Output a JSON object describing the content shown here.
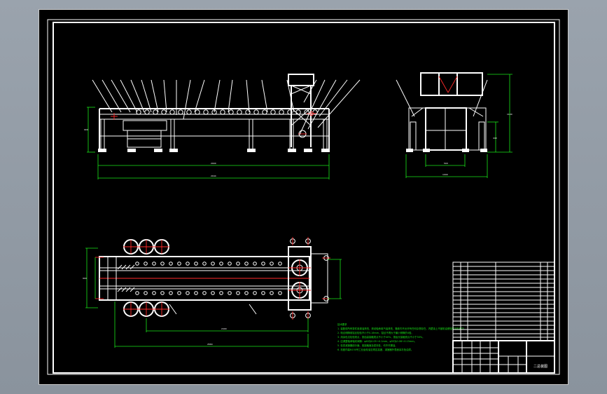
{
  "notes": {
    "title": "技术要求",
    "lines": [
      "1. 装配前所有零件用煤油清洗，滚动轴承用汽油清洗，箱体内不允许有任何杂物存在，内壁涂上不被机油侵蚀的涂料两次。",
      "2. 啮合侧隙用铅丝检验不小于0.16mm，铅丝不得大于最小侧隙的4倍。",
      "3. 用涂色法检验斑点，按齿高接触斑点不小于40%，按齿长接触斑点不小于50%。",
      "4. 应调整轴承轴向间隙：φ40为0.05～0.1mm，φ55为0.08～0.15mm。",
      "5. 检查减速器剖分面、各接触面及密封处，均不许漏油。",
      "6. 机座内装N150号工业齿轮油至规定高度，减速器外表面涂灰色油漆。"
    ]
  },
  "title_block": {
    "drawing_name": "二总装图"
  },
  "colors": {
    "background": "#000000",
    "frame": "#ffffff",
    "dimension": "#19e619",
    "centerline": "#ff2a2a",
    "screen": "#8f98a2"
  }
}
